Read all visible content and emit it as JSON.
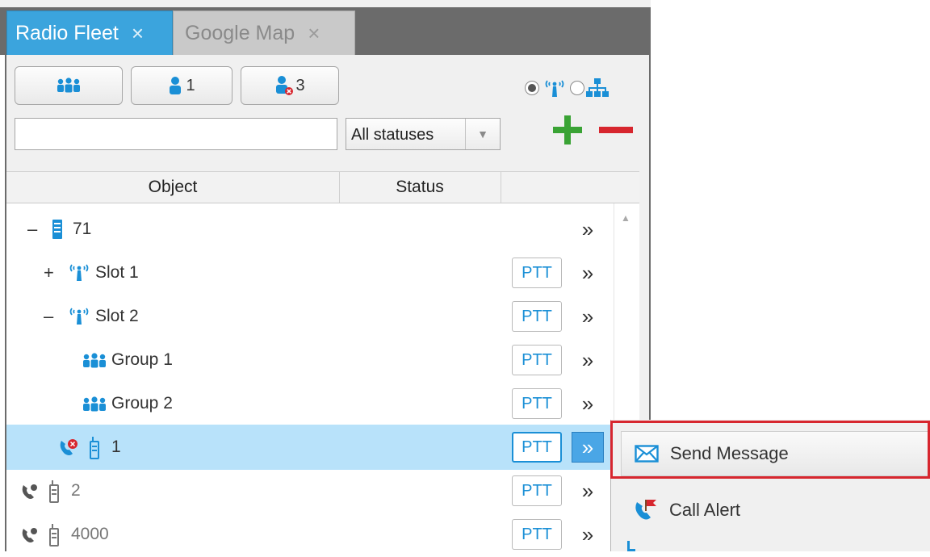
{
  "tabs": [
    {
      "label": "Radio Fleet",
      "close": "×",
      "active": true
    },
    {
      "label": "Google Map",
      "close": "×",
      "active": false
    }
  ],
  "toolbar": {
    "groups_button": {
      "icon": "group-icon"
    },
    "online_button": {
      "icon": "user-icon",
      "count": "1"
    },
    "offline_button": {
      "icon": "user-offline-icon",
      "count": "3"
    },
    "view_mode": {
      "options": [
        "radio-tower-icon",
        "hierarchy-icon"
      ],
      "selected": 0
    }
  },
  "filter": {
    "search_value": "",
    "status_select": "All statuses"
  },
  "table": {
    "headers": [
      "Object",
      "Status",
      ""
    ],
    "rows": [
      {
        "toggle": "–",
        "icon": "repeater-icon",
        "label": "71",
        "ptt": "",
        "more": "»"
      },
      {
        "toggle": "+",
        "icon": "antenna-icon",
        "label": "Slot 1",
        "ptt": "PTT",
        "more": "»"
      },
      {
        "toggle": "–",
        "icon": "antenna-icon",
        "label": "Slot 2",
        "ptt": "PTT",
        "more": "»"
      },
      {
        "toggle": "",
        "icon": "group-icon",
        "label": "Group 1",
        "ptt": "PTT",
        "more": "»"
      },
      {
        "toggle": "",
        "icon": "group-icon",
        "label": "Group 2",
        "ptt": "PTT",
        "more": "»"
      },
      {
        "toggle": "",
        "icon": "radio-handset-icon",
        "label": "1",
        "ptt": "PTT",
        "more": "»",
        "selected": true
      },
      {
        "toggle": "",
        "icon": "radio-handset-icon",
        "label": "2",
        "ptt": "PTT",
        "more": "»"
      },
      {
        "toggle": "",
        "icon": "radio-handset-icon",
        "label": "4000",
        "ptt": "PTT",
        "more": "»"
      }
    ]
  },
  "context_menu": {
    "items": [
      {
        "label": "Send Message",
        "icon": "envelope-icon",
        "highlighted": true
      },
      {
        "label": "Call Alert",
        "icon": "call-alert-icon"
      }
    ]
  },
  "colors": {
    "accent": "#3ba4dd",
    "ptt_text": "#1a8fd6",
    "selected_row": "#b8e2fa",
    "highlight_border": "#d7262e",
    "add": "#3aa335",
    "remove": "#d7262e"
  }
}
